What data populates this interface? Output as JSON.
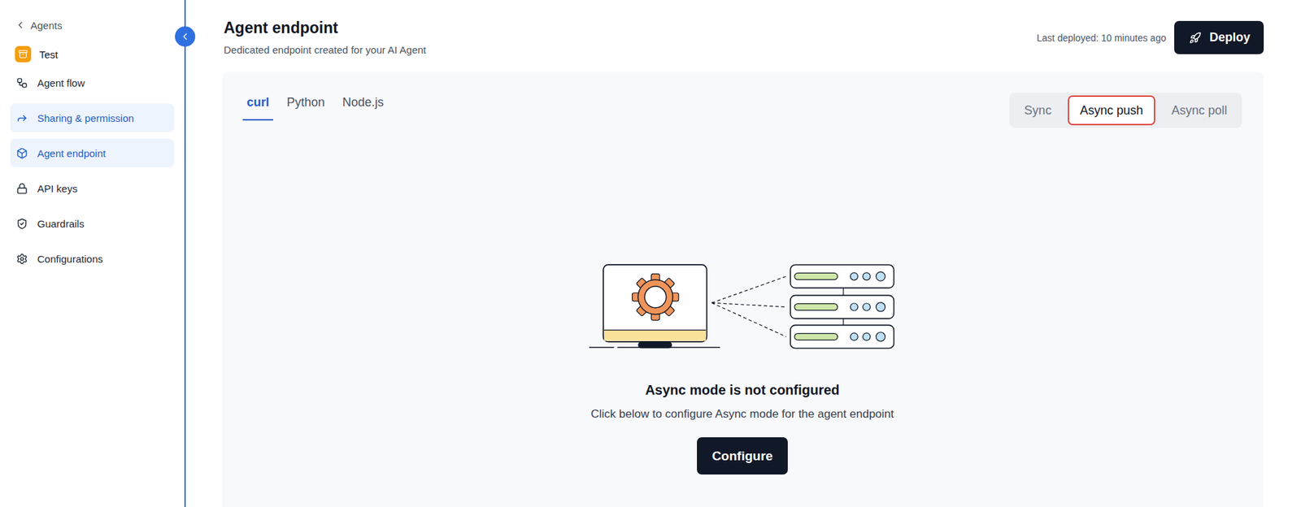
{
  "sidebar": {
    "back": "Agents",
    "agent": "Test",
    "items": [
      {
        "label": "Agent flow",
        "icon": "flow",
        "selected": false,
        "hovered": false
      },
      {
        "label": "Sharing & permission",
        "icon": "share",
        "selected": false,
        "hovered": true
      },
      {
        "label": "Agent endpoint",
        "icon": "box",
        "selected": true,
        "hovered": false
      },
      {
        "label": "API keys",
        "icon": "lock",
        "selected": false,
        "hovered": false
      },
      {
        "label": "Guardrails",
        "icon": "shield",
        "selected": false,
        "hovered": false
      },
      {
        "label": "Configurations",
        "icon": "settings",
        "selected": false,
        "hovered": false
      }
    ]
  },
  "header": {
    "title": "Agent endpoint",
    "subtitle": "Dedicated endpoint created for your AI Agent",
    "last_deployed": "Last deployed: 10 minutes ago",
    "deploy_button": "Deploy"
  },
  "language_tabs": [
    {
      "label": "curl",
      "selected": true
    },
    {
      "label": "Python",
      "selected": false
    },
    {
      "label": "Node.js",
      "selected": false
    }
  ],
  "mode_tabs": [
    {
      "label": "Sync",
      "selected": false
    },
    {
      "label": "Async push",
      "selected": true
    },
    {
      "label": "Async poll",
      "selected": false
    }
  ],
  "empty_state": {
    "title": "Async mode is not configured",
    "description": "Click below to configure Async mode for the agent endpoint",
    "button": "Configure"
  }
}
